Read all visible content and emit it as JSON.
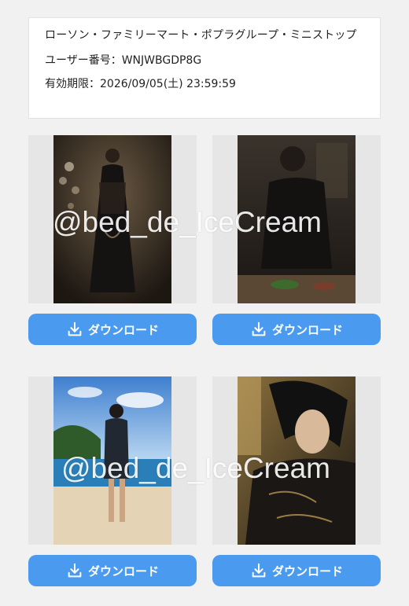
{
  "pass": {
    "stores": "ローソン・ファミリーマート・ポプラグループ・ミニストップ",
    "user_number": "ユーザー番号：WNJWBGDP8G",
    "expiry": "有効期限：2026/09/05(土) 23:59:59"
  },
  "gallery": {
    "items": [
      {
        "download_label": "ダウンロード"
      },
      {
        "download_label": "ダウンロード"
      },
      {
        "download_label": "ダウンロード"
      },
      {
        "download_label": "ダウンロード"
      }
    ]
  },
  "watermark": "@bed_de_IceCream",
  "colors": {
    "button": "#4a9bf0",
    "background": "#f1f1f1"
  },
  "icons": {
    "download": "download-icon"
  }
}
